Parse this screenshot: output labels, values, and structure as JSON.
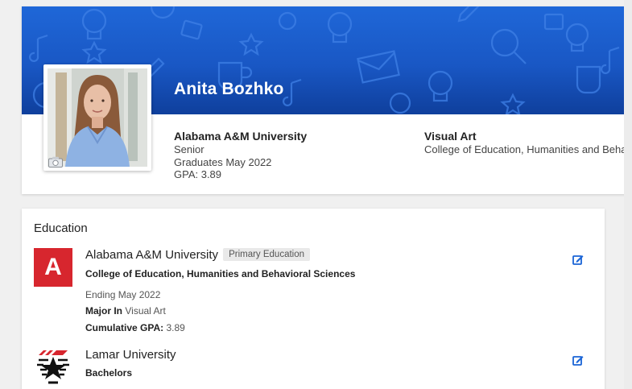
{
  "profile": {
    "name": "Anita Bozhko",
    "university": "Alabama A&M University",
    "class_level": "Senior",
    "graduation": "Graduates May 2022",
    "gpa": "GPA: 3.89",
    "major": "Visual Art",
    "college": "College of Education, Humanities and Behavioral Sciences"
  },
  "education": {
    "title": "Education",
    "entries": [
      {
        "school": "Alabama A&M University",
        "badge": "Primary Education",
        "logo_letter": "A",
        "college": "College of Education, Humanities and Behavioral Sciences",
        "ending": "Ending May 2022",
        "major_label": "Major In",
        "major_value": "Visual Art",
        "gpa_label": "Cumulative GPA:",
        "gpa_value": "3.89"
      },
      {
        "school": "Lamar University",
        "degree": "Bachelors"
      }
    ]
  },
  "colors": {
    "banner": "#1f67d8",
    "aamu_red": "#d7262e",
    "edit_blue": "#1a64d6"
  },
  "icons": [
    "camera-icon",
    "edit-icon"
  ]
}
